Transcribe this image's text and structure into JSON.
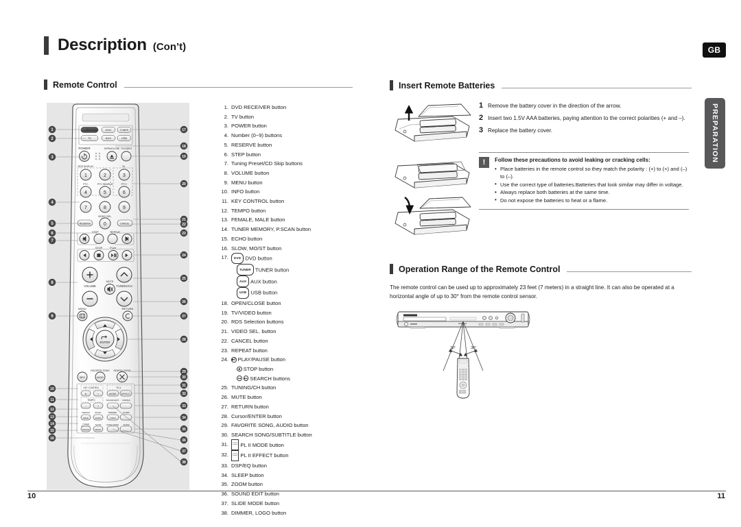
{
  "document": {
    "title_main": "Description",
    "title_sub": "(Con’t)",
    "language_badge": "GB",
    "side_tab": "PREPARATION",
    "page_left": "10",
    "page_right": "11"
  },
  "left_page": {
    "section_title": "Remote Control",
    "button_list": [
      {
        "num": "1.",
        "text": "DVD RECEIVER button"
      },
      {
        "num": "2.",
        "text": "TV button"
      },
      {
        "num": "3.",
        "text": "POWER button"
      },
      {
        "num": "4.",
        "text": "Number (0~9) buttons"
      },
      {
        "num": "5.",
        "text": "RESERVE button"
      },
      {
        "num": "6.",
        "text": "STEP button"
      },
      {
        "num": "7.",
        "text": "Tuning Preset/CD Skip buttons"
      },
      {
        "num": "8.",
        "text": "VOLUME button"
      },
      {
        "num": "9.",
        "text": "MENU button"
      },
      {
        "num": "10.",
        "text": "INFO button"
      },
      {
        "num": "11.",
        "text": "KEY CONTROL button"
      },
      {
        "num": "12.",
        "text": "TEMPO button"
      },
      {
        "num": "13.",
        "text": "FEMALE, MALE button"
      },
      {
        "num": "14.",
        "text": "TUNER MEMORY, P.SCAN button"
      },
      {
        "num": "15.",
        "text": "ECHO button"
      },
      {
        "num": "16.",
        "text": "SLOW, MO/ST button"
      },
      {
        "num": "17.",
        "text": "DVD button",
        "pill": "DVD"
      },
      {
        "num": "",
        "text": "TUNER button",
        "pill": "TUNER",
        "sub": true
      },
      {
        "num": "",
        "text": "AUX button",
        "pill": "AUX",
        "sub": true
      },
      {
        "num": "",
        "text": "USB button",
        "pill": "USB",
        "sub": true
      },
      {
        "num": "18.",
        "text": "OPEN/CLOSE button"
      },
      {
        "num": "19.",
        "text": "TV/VIDEO button"
      },
      {
        "num": "20.",
        "text": "RDS Selection buttons"
      },
      {
        "num": "21.",
        "text": "VIDEO SEL. button"
      },
      {
        "num": "22.",
        "text": "CANCEL button"
      },
      {
        "num": "23.",
        "text": "REPEAT button"
      },
      {
        "num": "24.",
        "text": "PLAY/PAUSE button",
        "circ": "▶‖"
      },
      {
        "num": "",
        "text": "STOP button",
        "circ": "■",
        "sub": true
      },
      {
        "num": "",
        "text": "SEARCH buttons",
        "circ2": true,
        "sub": true
      },
      {
        "num": "25.",
        "text": "TUNING/CH button"
      },
      {
        "num": "26.",
        "text": "MUTE button"
      },
      {
        "num": "27.",
        "text": "RETURN button"
      },
      {
        "num": "28.",
        "text": "Cursor/ENTER button"
      },
      {
        "num": "29.",
        "text": "FAVORITE SONG, AUDIO button"
      },
      {
        "num": "30.",
        "text": "SEARCH SONG/SUBTITLE button"
      },
      {
        "num": "31.",
        "text": "PL II MODE button",
        "prologic": true
      },
      {
        "num": "32.",
        "text": "PL II EFFECT button",
        "prologic": true
      },
      {
        "num": "33.",
        "text": "DSP/EQ button"
      },
      {
        "num": "34.",
        "text": "SLEEP button"
      },
      {
        "num": "35.",
        "text": "ZOOM button"
      },
      {
        "num": "36.",
        "text": "SOUND EDIT button"
      },
      {
        "num": "37.",
        "text": "SLIDE MODE button"
      },
      {
        "num": "38.",
        "text": "DIMMER, LOGO button"
      }
    ],
    "remote_labels": {
      "source_dvd_receiver": "DVDRECEIVER",
      "source_tv": "TV",
      "source_dvd": "DVD",
      "source_tuner": "TUNER",
      "source_aux": "AUX",
      "source_usb": "USB",
      "power": "POWER",
      "open_close": "OPEN/CLOSE",
      "tv_video": "TV/VIDEO",
      "rds_display": "RDS DISPLAY",
      "ta": "TA",
      "pty_minus": "PTY-",
      "pty_search": "PTY SEARCH",
      "pty_plus": "PTY+",
      "video_sel": "VIDEO SEL.",
      "reserve": "RESERVE",
      "cancel": "CANCEL",
      "step": "STEP",
      "repeat": "REPEAT",
      "stop": "STOP",
      "play": "PLAY",
      "volume": "VOLUME",
      "mute": "MUTE",
      "tuning_ch": "TUNING/CH",
      "menu": "MENU",
      "return": "RETURN",
      "enter": "ENTER",
      "info": "INFO",
      "favorite_song": "FAVORITE SONG",
      "audio": "AUDIO",
      "search_song": "SEARCH SONG",
      "key_control": "KEY CONTROL",
      "pl_ii": "PL II",
      "mode": "MODE",
      "effect": "EFFECT",
      "tempo": "TEMPO",
      "sound_edit": "SOUND EDIT",
      "dsp_eq": "DSP/EQ",
      "female": "FEMALE",
      "male": "MALE",
      "echo": "ECHO",
      "dimmer": "DIMMER",
      "logo": "LOGO",
      "sleep": "SLEEP",
      "tuner_memory": "TUNER MEMORY",
      "p_scan": "P.SCAN",
      "slow": "SLOW",
      "mo_st": "MO/ST",
      "slide_mode": "SLIDE MODE",
      "zoom": "ZOOM",
      "keys": [
        "1",
        "2",
        "3",
        "4",
        "5",
        "6",
        "7",
        "8",
        "9",
        "0"
      ]
    },
    "callout_numbers_left": [
      "1",
      "2",
      "3",
      "4",
      "5",
      "6",
      "7",
      "8",
      "9",
      "10",
      "11",
      "12",
      "13",
      "14",
      "15",
      "16"
    ],
    "callout_numbers_right": [
      "17",
      "18",
      "19",
      "20",
      "21",
      "22",
      "23",
      "24",
      "25",
      "26",
      "27",
      "28",
      "29",
      "30",
      "31",
      "32",
      "33",
      "34",
      "35",
      "36",
      "37",
      "38"
    ]
  },
  "right_page": {
    "batteries": {
      "section_title": "Insert Remote Batteries",
      "steps": [
        {
          "num": "1",
          "text": "Remove the battery cover in the direction of the arrow."
        },
        {
          "num": "2",
          "text": "Insert two 1.5V AAA batteries, paying attention to the correct polarities (+ and –)."
        },
        {
          "num": "3",
          "text": "Replace the battery cover."
        }
      ],
      "caution": {
        "icon": "!",
        "title": "Follow these precautions to avoid leaking or cracking cells:",
        "items": [
          "Place batteries in the remote control so they match the polarity : (+) to (+) and (–) to (–).",
          "Use the correct type of batteries.Batteries that look similar may differ in voltage.",
          "Always replace both batteries at the same time.",
          "Do not expose the batteries to heat or a flame."
        ]
      }
    },
    "operation_range": {
      "section_title": "Operation Range of the Remote Control",
      "body": "The remote control can be used up to approximately 23 feet (7 meters) in a straight line. It can also be operated at a horizontal angle of up to 30° from the remote control sensor.",
      "angle_label_left": "30°",
      "angle_label_right": "30°",
      "device_brand": "SAMSUNG"
    }
  }
}
